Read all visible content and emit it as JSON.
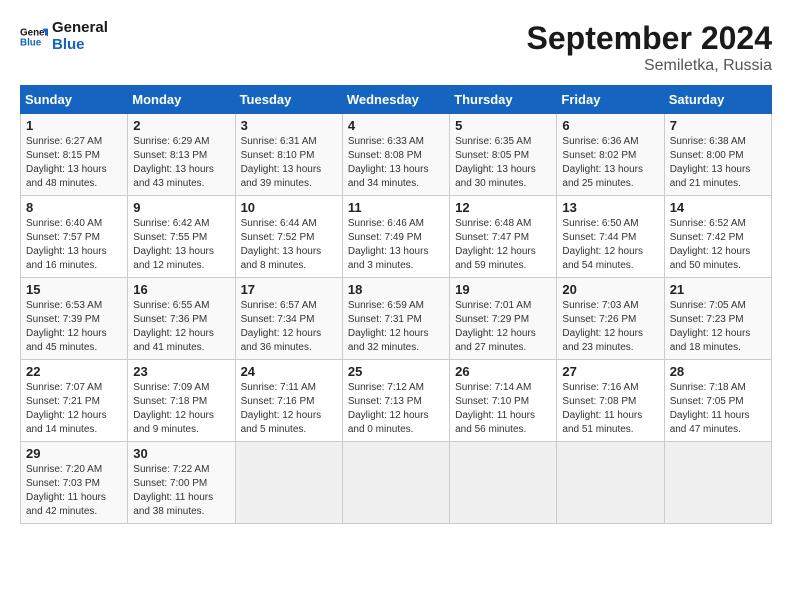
{
  "header": {
    "logo_line1": "General",
    "logo_line2": "Blue",
    "title": "September 2024",
    "subtitle": "Semiletka, Russia"
  },
  "weekdays": [
    "Sunday",
    "Monday",
    "Tuesday",
    "Wednesday",
    "Thursday",
    "Friday",
    "Saturday"
  ],
  "weeks": [
    [
      {
        "day": "1",
        "sunrise": "6:27 AM",
        "sunset": "8:15 PM",
        "daylight": "13 hours and 48 minutes."
      },
      {
        "day": "2",
        "sunrise": "6:29 AM",
        "sunset": "8:13 PM",
        "daylight": "13 hours and 43 minutes."
      },
      {
        "day": "3",
        "sunrise": "6:31 AM",
        "sunset": "8:10 PM",
        "daylight": "13 hours and 39 minutes."
      },
      {
        "day": "4",
        "sunrise": "6:33 AM",
        "sunset": "8:08 PM",
        "daylight": "13 hours and 34 minutes."
      },
      {
        "day": "5",
        "sunrise": "6:35 AM",
        "sunset": "8:05 PM",
        "daylight": "13 hours and 30 minutes."
      },
      {
        "day": "6",
        "sunrise": "6:36 AM",
        "sunset": "8:02 PM",
        "daylight": "13 hours and 25 minutes."
      },
      {
        "day": "7",
        "sunrise": "6:38 AM",
        "sunset": "8:00 PM",
        "daylight": "13 hours and 21 minutes."
      }
    ],
    [
      {
        "day": "8",
        "sunrise": "6:40 AM",
        "sunset": "7:57 PM",
        "daylight": "13 hours and 16 minutes."
      },
      {
        "day": "9",
        "sunrise": "6:42 AM",
        "sunset": "7:55 PM",
        "daylight": "13 hours and 12 minutes."
      },
      {
        "day": "10",
        "sunrise": "6:44 AM",
        "sunset": "7:52 PM",
        "daylight": "13 hours and 8 minutes."
      },
      {
        "day": "11",
        "sunrise": "6:46 AM",
        "sunset": "7:49 PM",
        "daylight": "13 hours and 3 minutes."
      },
      {
        "day": "12",
        "sunrise": "6:48 AM",
        "sunset": "7:47 PM",
        "daylight": "12 hours and 59 minutes."
      },
      {
        "day": "13",
        "sunrise": "6:50 AM",
        "sunset": "7:44 PM",
        "daylight": "12 hours and 54 minutes."
      },
      {
        "day": "14",
        "sunrise": "6:52 AM",
        "sunset": "7:42 PM",
        "daylight": "12 hours and 50 minutes."
      }
    ],
    [
      {
        "day": "15",
        "sunrise": "6:53 AM",
        "sunset": "7:39 PM",
        "daylight": "12 hours and 45 minutes."
      },
      {
        "day": "16",
        "sunrise": "6:55 AM",
        "sunset": "7:36 PM",
        "daylight": "12 hours and 41 minutes."
      },
      {
        "day": "17",
        "sunrise": "6:57 AM",
        "sunset": "7:34 PM",
        "daylight": "12 hours and 36 minutes."
      },
      {
        "day": "18",
        "sunrise": "6:59 AM",
        "sunset": "7:31 PM",
        "daylight": "12 hours and 32 minutes."
      },
      {
        "day": "19",
        "sunrise": "7:01 AM",
        "sunset": "7:29 PM",
        "daylight": "12 hours and 27 minutes."
      },
      {
        "day": "20",
        "sunrise": "7:03 AM",
        "sunset": "7:26 PM",
        "daylight": "12 hours and 23 minutes."
      },
      {
        "day": "21",
        "sunrise": "7:05 AM",
        "sunset": "7:23 PM",
        "daylight": "12 hours and 18 minutes."
      }
    ],
    [
      {
        "day": "22",
        "sunrise": "7:07 AM",
        "sunset": "7:21 PM",
        "daylight": "12 hours and 14 minutes."
      },
      {
        "day": "23",
        "sunrise": "7:09 AM",
        "sunset": "7:18 PM",
        "daylight": "12 hours and 9 minutes."
      },
      {
        "day": "24",
        "sunrise": "7:11 AM",
        "sunset": "7:16 PM",
        "daylight": "12 hours and 5 minutes."
      },
      {
        "day": "25",
        "sunrise": "7:12 AM",
        "sunset": "7:13 PM",
        "daylight": "12 hours and 0 minutes."
      },
      {
        "day": "26",
        "sunrise": "7:14 AM",
        "sunset": "7:10 PM",
        "daylight": "11 hours and 56 minutes."
      },
      {
        "day": "27",
        "sunrise": "7:16 AM",
        "sunset": "7:08 PM",
        "daylight": "11 hours and 51 minutes."
      },
      {
        "day": "28",
        "sunrise": "7:18 AM",
        "sunset": "7:05 PM",
        "daylight": "11 hours and 47 minutes."
      }
    ],
    [
      {
        "day": "29",
        "sunrise": "7:20 AM",
        "sunset": "7:03 PM",
        "daylight": "11 hours and 42 minutes."
      },
      {
        "day": "30",
        "sunrise": "7:22 AM",
        "sunset": "7:00 PM",
        "daylight": "11 hours and 38 minutes."
      },
      null,
      null,
      null,
      null,
      null
    ]
  ]
}
